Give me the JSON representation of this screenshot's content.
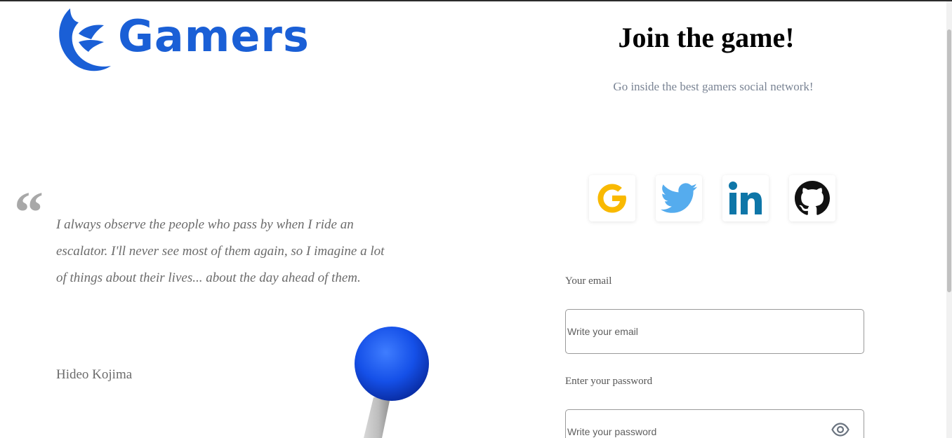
{
  "brand": {
    "name": "Gamers",
    "color": "#1a5fd6",
    "logo_icon": "wing-logo-icon"
  },
  "quote": {
    "mark": "“",
    "text": "I always observe the people who pass by when I ride an escalator. I'll never see most of them again, so I imagine a lot of things about their lives... about the day ahead of them.",
    "author": "Hideo Kojima"
  },
  "illustration": {
    "icon": "joystick-icon",
    "ball_color": "#1550e8"
  },
  "signup": {
    "title": "Join the game!",
    "subtitle": "Go inside the best gamers social network!",
    "social": [
      {
        "name": "Google",
        "icon": "google-icon",
        "color": "#f9b900"
      },
      {
        "name": "Twitter",
        "icon": "twitter-icon",
        "color": "#55acee"
      },
      {
        "name": "LinkedIn",
        "icon": "linkedin-icon",
        "color": "#0e76a8"
      },
      {
        "name": "GitHub",
        "icon": "github-icon",
        "color": "#111111"
      }
    ],
    "email": {
      "label": "Your email",
      "placeholder": "Write your email",
      "value": ""
    },
    "password": {
      "label": "Enter your password",
      "placeholder": "Write your password",
      "value": "",
      "toggle_icon": "eye-icon"
    }
  }
}
